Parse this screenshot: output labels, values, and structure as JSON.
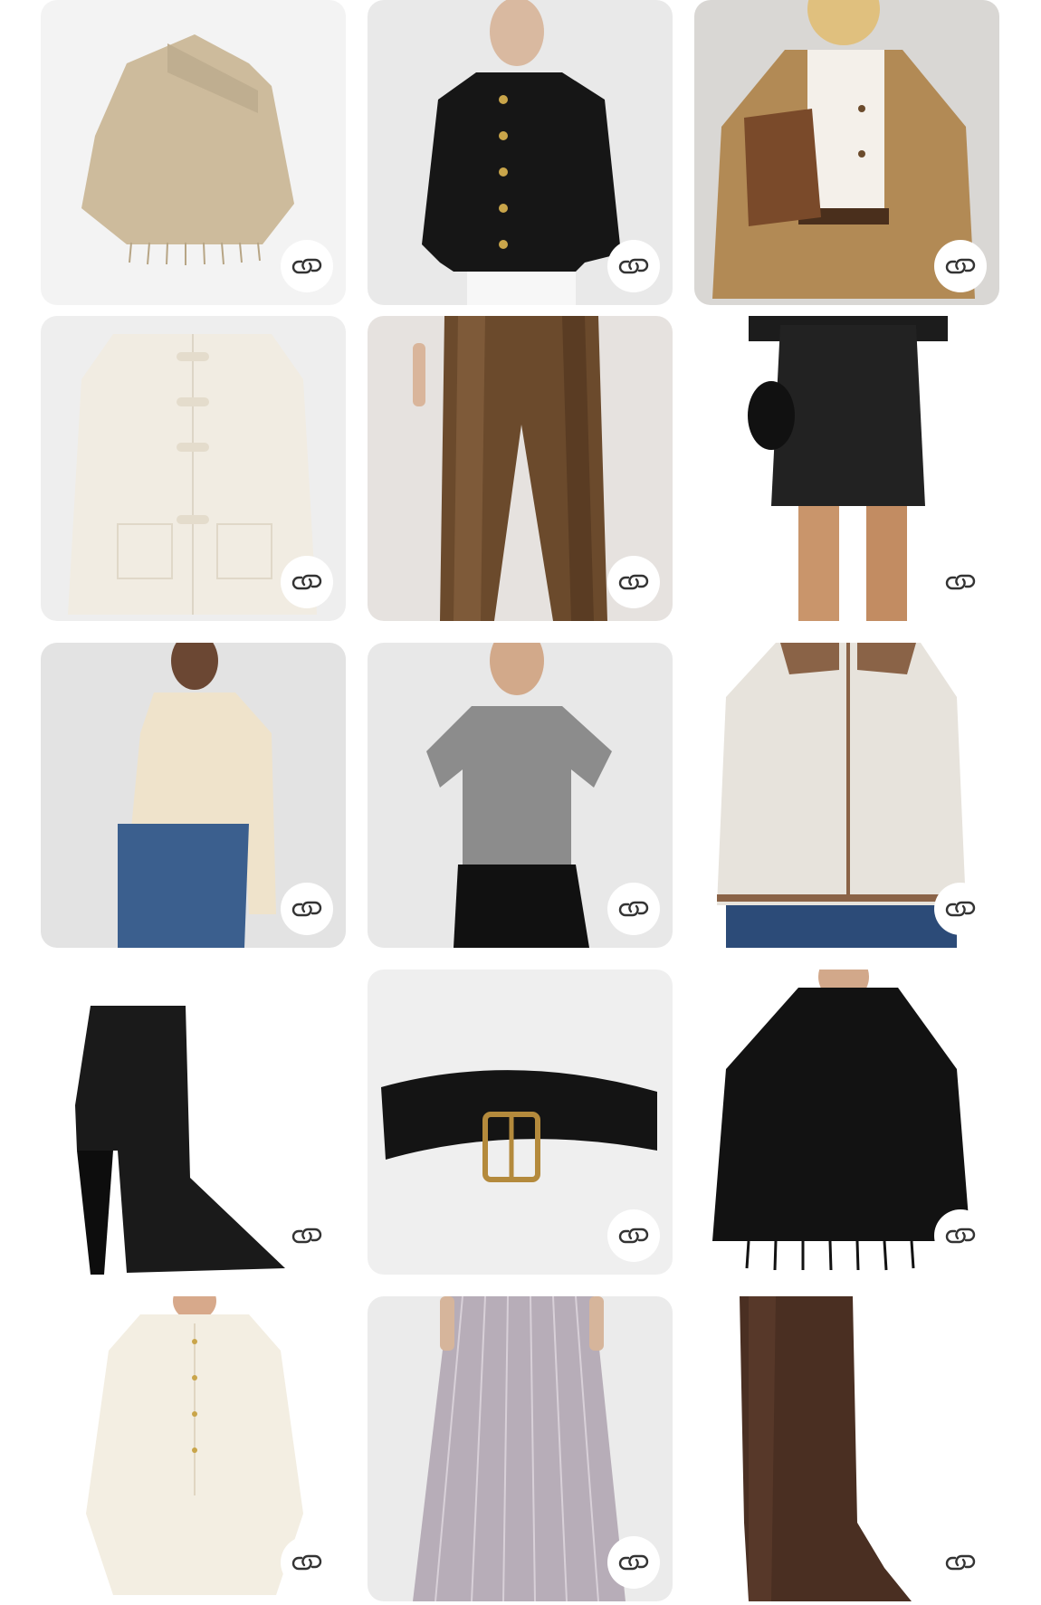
{
  "page": {
    "background": "#ffffff"
  },
  "link_button": {
    "icon": "link-chain-icon",
    "color": "#333333"
  },
  "products": [
    {
      "item": "beige-fringe-scarf-poncho",
      "bg": "#f3f3f3",
      "color": "#cdbb9c",
      "link_style": "circle"
    },
    {
      "item": "black-tweed-jacket",
      "bg": "#e9e9e9",
      "color": "#161616",
      "link_style": "circle"
    },
    {
      "item": "camel-car-coat",
      "bg": "#d9d7d4",
      "color": "#b28a55",
      "link_style": "circle"
    },
    {
      "item": "cream-toggle-jacket",
      "bg": "#eeeeee",
      "color": "#f1ece2",
      "link_style": "circle"
    },
    {
      "item": "brown-satin-trousers",
      "bg": "#e6e2df",
      "color": "#6b4a2c",
      "link_style": "circle"
    },
    {
      "item": "black-leather-pencil-skirt",
      "bg": "#ffffff",
      "color": "#222222",
      "link_style": "plain"
    },
    {
      "item": "cream-silk-jacket",
      "bg": "#e3e3e3",
      "color": "#efe3cb",
      "link_style": "circle"
    },
    {
      "item": "grey-knit-polo",
      "bg": "#e8e8e8",
      "color": "#8c8c8c",
      "link_style": "circle"
    },
    {
      "item": "quilted-cream-jacket",
      "bg": "#ffffff",
      "color": "#e7e3dc",
      "link_style": "circle"
    },
    {
      "item": "black-ankle-boot",
      "bg": "#ffffff",
      "color": "#1a1a1a",
      "link_style": "plain"
    },
    {
      "item": "wide-black-belt",
      "bg": "#efefef",
      "color": "#141414",
      "link_style": "circle"
    },
    {
      "item": "black-fringe-scarf",
      "bg": "#ffffff",
      "color": "#121212",
      "link_style": "circle"
    },
    {
      "item": "cream-puff-sleeve-blouse",
      "bg": "#ffffff",
      "color": "#f3eee2",
      "link_style": "circle"
    },
    {
      "item": "striped-midi-skirt",
      "bg": "#ebebeb",
      "color": "#b7adb8",
      "link_style": "circle"
    },
    {
      "item": "brown-suede-knee-boot",
      "bg": "#ffffff",
      "color": "#4a2f22",
      "link_style": "plain"
    }
  ]
}
